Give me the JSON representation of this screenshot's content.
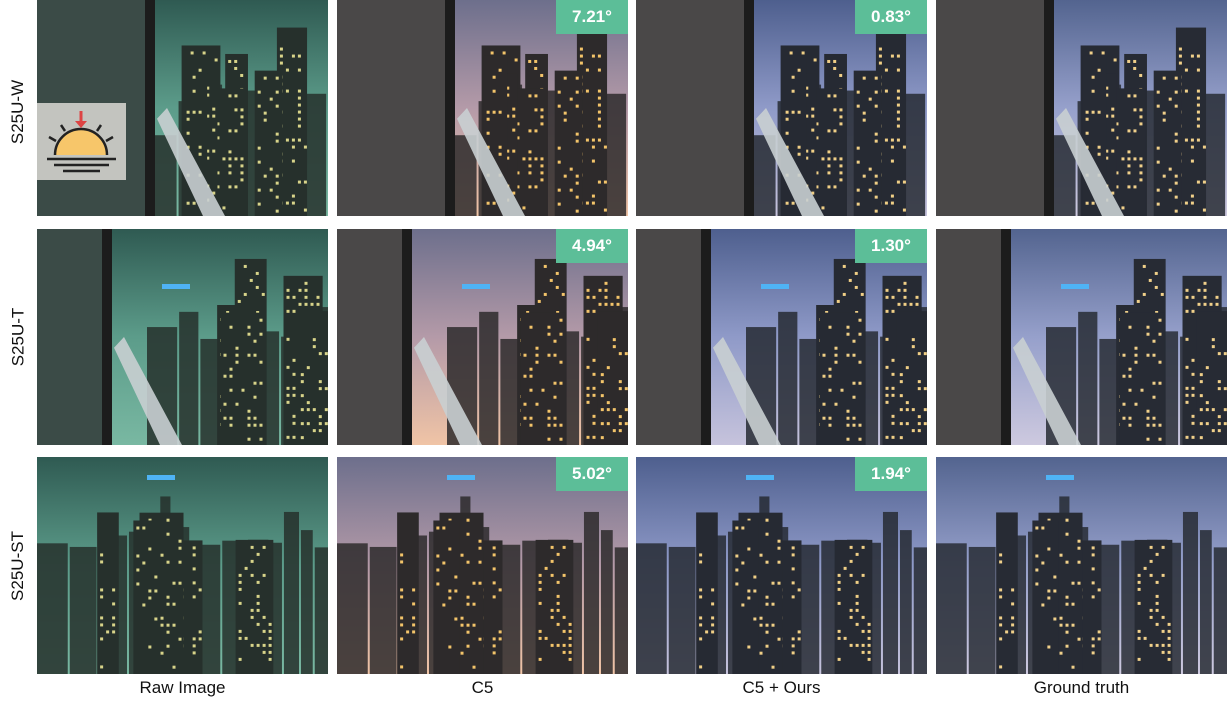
{
  "row_labels": [
    "S25U-W",
    "S25U-T",
    "S25U-ST"
  ],
  "column_labels": [
    "Raw Image",
    "C5",
    "C5 + Ours",
    "Ground truth"
  ],
  "angular_errors": {
    "c5": [
      "7.21°",
      "4.94°",
      "5.02°"
    ],
    "c5_ours": [
      "0.83°",
      "1.30°",
      "1.94°"
    ]
  },
  "badge_color": "#5cbe98",
  "indicator_icon": "sunset-icon",
  "tints": {
    "raw": "#64b4a0",
    "c5": "#d8a890",
    "c5_ours": "#a8b0d8",
    "ground_truth": "#b0b8dc"
  }
}
